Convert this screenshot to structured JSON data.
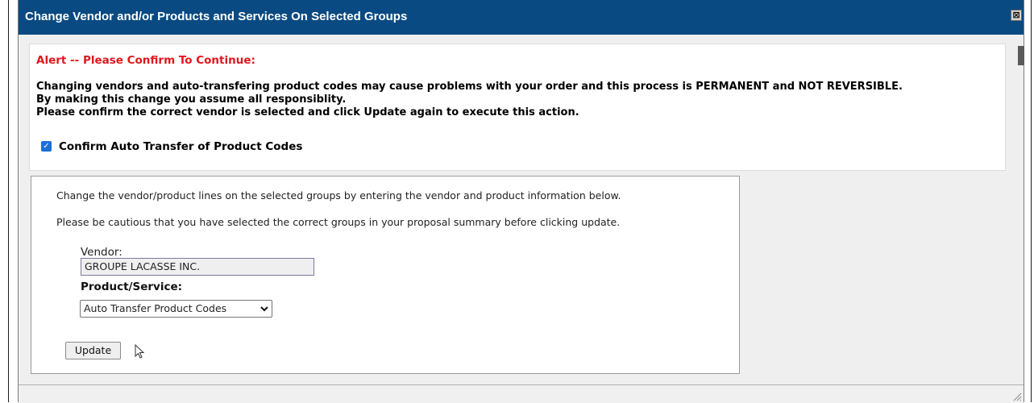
{
  "dialog": {
    "title": "Change Vendor and/or Products and Services On Selected Groups",
    "close_symbol": "⊠"
  },
  "alert": {
    "title": "Alert -- Please Confirm To Continue:",
    "line1": "Changing vendors and auto-transfering product codes may cause problems with your order and this process is PERMANENT and NOT REVERSIBLE.",
    "line2": "By making this change you assume all responsiblity.",
    "line3": "Please confirm the correct vendor is selected and click Update again to execute this action.",
    "confirm_label": "Confirm Auto Transfer of Product Codes",
    "confirm_checked": true
  },
  "form": {
    "instruction1": "Change the vendor/product lines on the selected groups by entering the vendor and product information below.",
    "instruction2": "Please be cautious that you have selected the correct groups in your proposal summary before clicking update.",
    "vendor_label": "Vendor:",
    "vendor_value": "GROUPE LACASSE INC.",
    "product_label": "Product/Service:",
    "product_selected": "Auto Transfer Product Codes",
    "update_label": "Update"
  },
  "colors": {
    "titlebar": "#0a4a82",
    "alert_title": "#e0161c",
    "checkbox": "#1b6fd8"
  }
}
